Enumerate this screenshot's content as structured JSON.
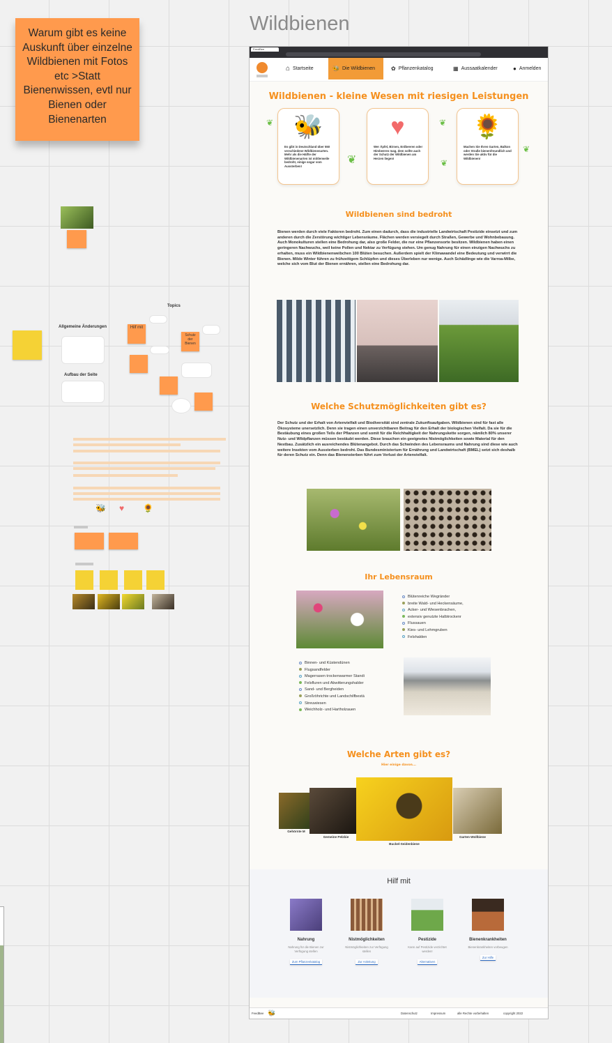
{
  "board": {
    "title": "Wildbienen",
    "sticky_note": "Warum gibt es keine Auskunft über einzelne Wildbienen mit Fotos etc >Statt Bienenwissen, evtl nur Bienen oder Bienenarten"
  },
  "mindmap": {
    "topics_label": "Topics",
    "heading_changes": "Allgemeine Änderungen",
    "heading_structure": "Aufbau der Seite",
    "note_hilf_mit": "Hilf mit",
    "note_schutz": "Schutz der Bienen"
  },
  "site": {
    "tab_label": "FeedBee",
    "nav": {
      "home": "Startseite",
      "wildbienen": "Die Wildbienen",
      "pflanzen": "Pflanzenkatalog",
      "kalender": "Aussaatkalender",
      "login": "Anmelden"
    },
    "hero_title": "Wildbienen - kleine Wesen mit riesigen Leistungen",
    "cards": [
      {
        "icon": "bee-icon",
        "text": "Es gibt in Deutschland über 550 verschiedene Wildbienenarten. Mehr als die Hälfte der Wildbienenarten ist mittlerweile bedroht, einige sogar vom Aussterben!"
      },
      {
        "icon": "heart-icon",
        "text": "Wer Äpfel, Birnen, Erdbeeren oder Himbeeren mag, dem sollte auch der Schutz der Wildbienen am Herzen liegen!"
      },
      {
        "icon": "sunflower-icon",
        "text": "Machen Sie Ihren Garten, Balkon oder Straße bienenfreundlich und werden Sie aktiv für die Wildbienen!"
      }
    ],
    "threat_title": "Wildbienen sind bedroht",
    "threat_text": "Bienen werden durch viele Faktoren bedroht. Zum einen dadurch, dass die industrielle Landwirtschaft Pestizide einsetzt und zum anderen durch die Zerstörung wichtiger Lebensräume. Flächen werden versiegelt durch Straßen, Gewerbe und Wohnbebauung. Auch Monokulturen stellen eine Bedrohung dar, also große Felder, die nur eine Pflanzensorte besitzen. Wildbienen haben einen geringeren Nachwuchs, weil keine Pollen und Nektar zu Verfügung stehen. Um genug Nahrung für einen einzigen Nachwuchs zu erhalten, muss ein Wildbienenweibchen 100 Blüten besuchen. Außerdem spielt der Klimawandel eine Bedeutung und verwirrt die Bienen. Milde Winter führen zu frühzeitigem Schlüpfen und dieses Überleben nur wenige. Auch Schädlinge wie die Varroa-Milbe, welche sich vom Blut der Bienen ernähren, stellen eine Bedrohung dar.",
    "protect_title": "Welche Schutzmöglichkeiten gibt es?",
    "protect_text": "Der Schutz und der Erhalt von Artenvielfalt und Biodiversität sind zentrale Zukunftsaufgaben. Wildbienen sind für fast alle Ökosysteme unersetzlich. Denn sie tragen einen unverzichtbaren Beitrag für den Erhalt der biologischen Vielfalt. Da sie für die Bestäubung eines großen Teils der Pflanzen und somit für die Reichhaltigkeit der Nahrungskette sorgen, nämlich 80% unserer Nutz- und Wildpflanzen müssen bestäubt werden. Diese brauchen ein geeignetes Nistmöglichkeiten sowie Material für den Nestbau. Zusätzlich ein ausreichendes Blütenangebot. Durch das Schwinden des Lebensraums und Nahrung sind diese wie auch weitere Insekten vom Aussterben bedroht. Das Bundesministerium für Ernährung und Landwirtschaft (BMEL) setzt sich deshalb für deren Schutz ein. Denn das Bienensterben führt zum Verlust der Artenvielfalt.",
    "habitat_title": "Ihr Lebensraum",
    "habitat_list_1": [
      "Blütenreiche Wegränder",
      "breite Wald- und Heckensäume,",
      "Acker- und Wiesenbrachen,",
      "extensiv genutzte Halbtrockenr",
      "Flussauen",
      "Kies- und Lehmgruben",
      "Felshalden"
    ],
    "habitat_list_2": [
      "Binnen- und Küstendünen",
      "Flugsandfelder",
      "Magerrasen trockenwarmer Standi",
      "Felsfluren und Abwitterungshalder",
      "Sand- und Bergheiden",
      "Großröhrichte und Landschilfbestä",
      "Streuwiesen",
      "Weichholz- und Hartholzauen"
    ],
    "species_title": "Welche Arten gibt es?",
    "species_subtitle": "Hier einige davon...",
    "species": [
      "Gehörnte M",
      "Gemeine Pelzbie",
      "Buckel-Seidenbiene",
      "Garten-Wollbiene"
    ],
    "help_title": "Hilf mit",
    "help": [
      {
        "title": "Nahrung",
        "text": "Nahrung für die Bienen zur Verfügung stellen",
        "button": "Zum Pflanzenkatalog"
      },
      {
        "title": "Nistmöglichkeiten",
        "text": "Nistmöglichkeiten zur Verfügung stellen",
        "button": "Zur Anleitung"
      },
      {
        "title": "Pestizide",
        "text": "Kann auf Pestizide verzichtet werden!",
        "button": "Alternativen"
      },
      {
        "title": "Bienenkrankheiten",
        "text": "Bienenkrankheiten vorbeugen",
        "button": "Zur Hilfe"
      }
    ],
    "footer": {
      "brand": "FeedBee",
      "privacy": "Datenschutz",
      "imprint": "Impressum",
      "rights": "alle Rechte vorbehalten",
      "copyright": "copyright 2022"
    }
  },
  "colors": {
    "accent": "#f5901e",
    "sticky": "#ff9a4d",
    "nav_active": "#f29b37"
  }
}
